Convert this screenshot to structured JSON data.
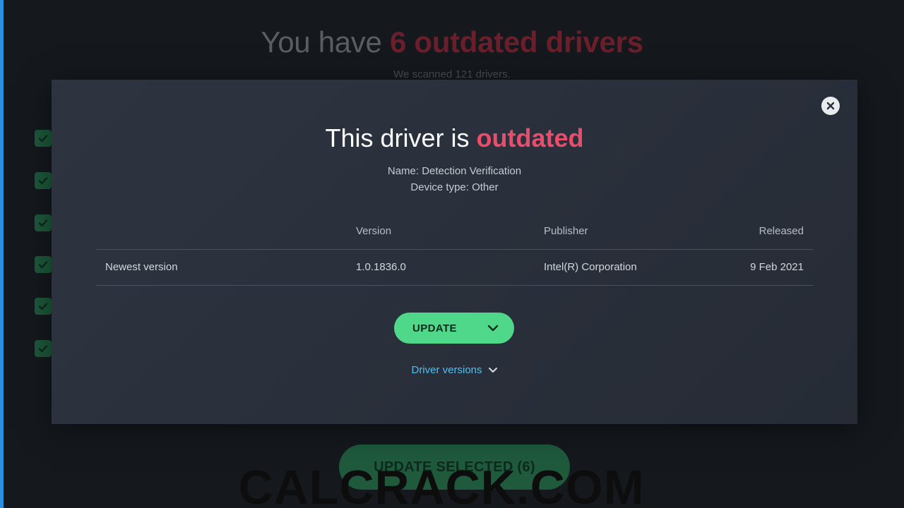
{
  "background": {
    "heading_prefix": "You have ",
    "heading_highlight": "6 outdated drivers",
    "subheading": "We scanned 121 drivers.",
    "update_selected_label": "UPDATE SELECTED (6)"
  },
  "watermark": "CALCRACK.COM",
  "modal": {
    "title_prefix": "This driver is ",
    "title_highlight": "outdated",
    "name_line": "Name: Detection Verification",
    "device_type_line": "Device type: Other",
    "table": {
      "headers": [
        "",
        "Version",
        "Publisher",
        "Released"
      ],
      "rows": [
        {
          "label": "Newest version",
          "version": "1.0.1836.0",
          "publisher": "Intel(R) Corporation",
          "released": "9 Feb 2021"
        }
      ]
    },
    "update_label": "UPDATE",
    "driver_versions_label": "Driver versions"
  },
  "colors": {
    "accent_red": "#ea4d6b",
    "accent_green": "#4fd88a",
    "link_blue": "#4fc0f0",
    "modal_bg": "#2a303b"
  },
  "icons": {
    "close": "close-icon",
    "checkbox": "checkmark-icon",
    "update_dropdown": "chevron-down-icon",
    "versions_dropdown": "chevron-down-icon"
  }
}
